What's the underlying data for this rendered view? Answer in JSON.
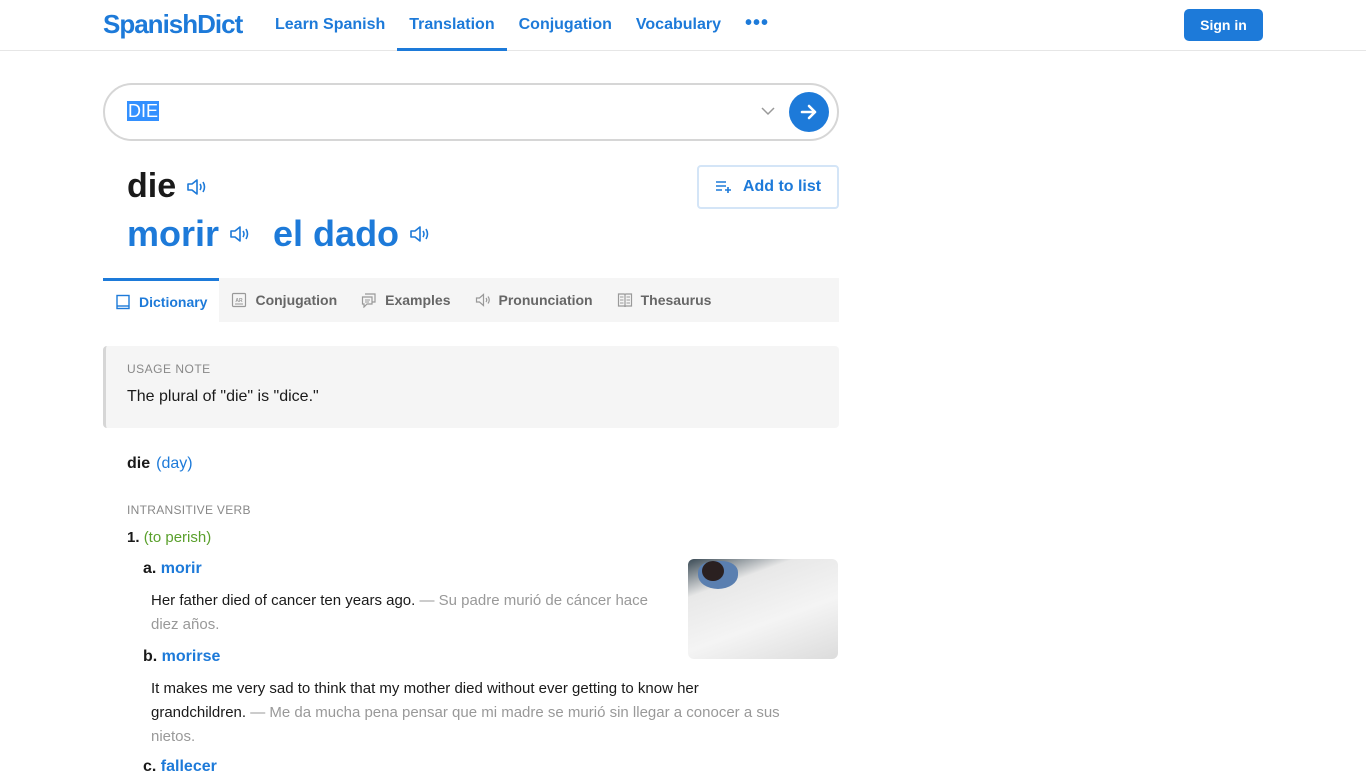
{
  "header": {
    "logo": "SpanishDict",
    "nav": [
      {
        "label": "Learn Spanish",
        "active": false
      },
      {
        "label": "Translation",
        "active": true
      },
      {
        "label": "Conjugation",
        "active": false
      },
      {
        "label": "Vocabulary",
        "active": false
      }
    ],
    "more_label": "•••",
    "signin_label": "Sign in"
  },
  "search": {
    "value": "DIE",
    "dropdown_icon": "chevron-down-icon",
    "submit_icon": "arrow-right-icon"
  },
  "entry": {
    "headword": "die",
    "translations": [
      "morir",
      "el dado"
    ],
    "add_to_list_label": "Add to list"
  },
  "tabs": [
    {
      "label": "Dictionary",
      "icon": "book-icon",
      "active": true
    },
    {
      "label": "Conjugation",
      "icon": "conjugation-icon",
      "active": false
    },
    {
      "label": "Examples",
      "icon": "examples-icon",
      "active": false
    },
    {
      "label": "Pronunciation",
      "icon": "speaker-icon",
      "active": false
    },
    {
      "label": "Thesaurus",
      "icon": "thesaurus-icon",
      "active": false
    }
  ],
  "usage_note": {
    "label": "USAGE NOTE",
    "text": "The plural of \"die\" is \"dice.\""
  },
  "dictionary": {
    "word": "die",
    "pronunciation": "(day)",
    "part_of_speech": "INTRANSITIVE VERB",
    "sense_number": "1.",
    "sense_context": "(to perish)",
    "subsenses": [
      {
        "letter": "a.",
        "word": "morir",
        "example_en": "Her father died of cancer ten years ago.",
        "separator": " — ",
        "example_es_line1": "Su padre murió de cáncer",
        "example_es_line2": "hace diez años."
      },
      {
        "letter": "b.",
        "word": "morirse",
        "example_en_line1": "It makes me very sad to think that my mother died without ever getting to know her",
        "example_en_line2": "grandchildren.",
        "separator": " — ",
        "example_es_line1": "Me da mucha pena pensar que mi madre se murió sin llegar a conocer a sus",
        "example_es_line2": "nietos."
      },
      {
        "letter": "c.",
        "word": "fallecer"
      }
    ]
  }
}
